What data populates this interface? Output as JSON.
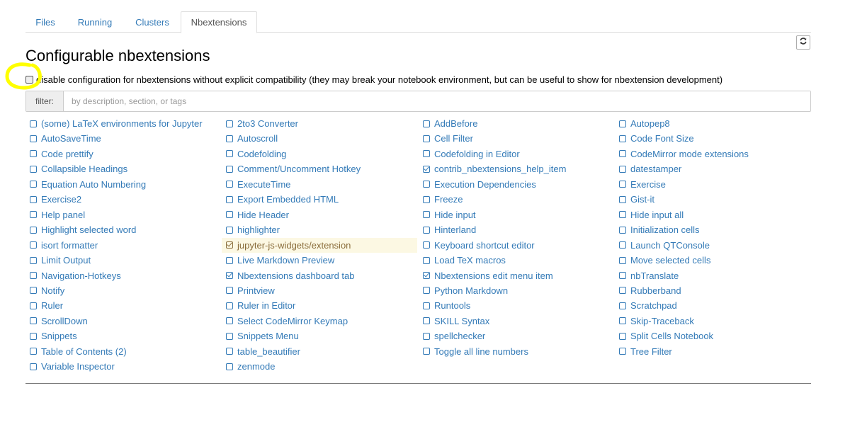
{
  "tabs": [
    {
      "label": "Files"
    },
    {
      "label": "Running"
    },
    {
      "label": "Clusters"
    },
    {
      "label": "Nbextensions"
    }
  ],
  "active_tab": "Nbextensions",
  "page_title": "Configurable nbextensions",
  "compat": {
    "label": "disable configuration for nbextensions without explicit compatibility (they may break your notebook environment, but can be useful to show for nbextension development)",
    "checked": false
  },
  "filter": {
    "label": "filter:",
    "placeholder": "by description, section, or tags",
    "value": ""
  },
  "icons": {
    "refresh": "refresh-icon",
    "checkbox": "checkbox-icon",
    "check": "check-icon"
  },
  "colors": {
    "link": "#337ab7",
    "selected_bg": "#fcf8e3",
    "selected_text": "#8a6d3b",
    "annotation": "#ffff00"
  },
  "extensions": {
    "columns": [
      {
        "items": [
          {
            "label": "(some) LaTeX environments for Jupyter",
            "checked": false
          },
          {
            "label": "AutoSaveTime",
            "checked": false
          },
          {
            "label": "Code prettify",
            "checked": false
          },
          {
            "label": "Collapsible Headings",
            "checked": false
          },
          {
            "label": "Equation Auto Numbering",
            "checked": false
          },
          {
            "label": "Exercise2",
            "checked": false
          },
          {
            "label": "Help panel",
            "checked": false
          },
          {
            "label": "Highlight selected word",
            "checked": false
          },
          {
            "label": "isort formatter",
            "checked": false
          },
          {
            "label": "Limit Output",
            "checked": false
          },
          {
            "label": "Navigation-Hotkeys",
            "checked": false
          },
          {
            "label": "Notify",
            "checked": false
          },
          {
            "label": "Ruler",
            "checked": false
          },
          {
            "label": "ScrollDown",
            "checked": false
          },
          {
            "label": "Snippets",
            "checked": false
          },
          {
            "label": "Table of Contents (2)",
            "checked": false
          },
          {
            "label": "Variable Inspector",
            "checked": false
          }
        ]
      },
      {
        "items": [
          {
            "label": "2to3 Converter",
            "checked": false
          },
          {
            "label": "Autoscroll",
            "checked": false
          },
          {
            "label": "Codefolding",
            "checked": false
          },
          {
            "label": "Comment/Uncomment Hotkey",
            "checked": false
          },
          {
            "label": "ExecuteTime",
            "checked": false
          },
          {
            "label": "Export Embedded HTML",
            "checked": false
          },
          {
            "label": "Hide Header",
            "checked": false
          },
          {
            "label": "highlighter",
            "checked": false
          },
          {
            "label": "jupyter-js-widgets/extension",
            "checked": true,
            "selected": true
          },
          {
            "label": "Live Markdown Preview",
            "checked": false
          },
          {
            "label": "Nbextensions dashboard tab",
            "checked": true
          },
          {
            "label": "Printview",
            "checked": false
          },
          {
            "label": "Ruler in Editor",
            "checked": false
          },
          {
            "label": "Select CodeMirror Keymap",
            "checked": false
          },
          {
            "label": "Snippets Menu",
            "checked": false
          },
          {
            "label": "table_beautifier",
            "checked": false
          },
          {
            "label": "zenmode",
            "checked": false
          }
        ]
      },
      {
        "items": [
          {
            "label": "AddBefore",
            "checked": false
          },
          {
            "label": "Cell Filter",
            "checked": false
          },
          {
            "label": "Codefolding in Editor",
            "checked": false
          },
          {
            "label": "contrib_nbextensions_help_item",
            "checked": true
          },
          {
            "label": "Execution Dependencies",
            "checked": false
          },
          {
            "label": "Freeze",
            "checked": false
          },
          {
            "label": "Hide input",
            "checked": false
          },
          {
            "label": "Hinterland",
            "checked": false
          },
          {
            "label": "Keyboard shortcut editor",
            "checked": false
          },
          {
            "label": "Load TeX macros",
            "checked": false
          },
          {
            "label": "Nbextensions edit menu item",
            "checked": true
          },
          {
            "label": "Python Markdown",
            "checked": false
          },
          {
            "label": "Runtools",
            "checked": false
          },
          {
            "label": "SKILL Syntax",
            "checked": false
          },
          {
            "label": "spellchecker",
            "checked": false
          },
          {
            "label": "Toggle all line numbers",
            "checked": false
          }
        ]
      },
      {
        "items": [
          {
            "label": "Autopep8",
            "checked": false
          },
          {
            "label": "Code Font Size",
            "checked": false
          },
          {
            "label": "CodeMirror mode extensions",
            "checked": false
          },
          {
            "label": "datestamper",
            "checked": false
          },
          {
            "label": "Exercise",
            "checked": false
          },
          {
            "label": "Gist-it",
            "checked": false
          },
          {
            "label": "Hide input all",
            "checked": false
          },
          {
            "label": "Initialization cells",
            "checked": false
          },
          {
            "label": "Launch QTConsole",
            "checked": false
          },
          {
            "label": "Move selected cells",
            "checked": false
          },
          {
            "label": "nbTranslate",
            "checked": false
          },
          {
            "label": "Rubberband",
            "checked": false
          },
          {
            "label": "Scratchpad",
            "checked": false
          },
          {
            "label": "Skip-Traceback",
            "checked": false
          },
          {
            "label": "Split Cells Notebook",
            "checked": false
          },
          {
            "label": "Tree Filter",
            "checked": false
          }
        ]
      }
    ]
  }
}
